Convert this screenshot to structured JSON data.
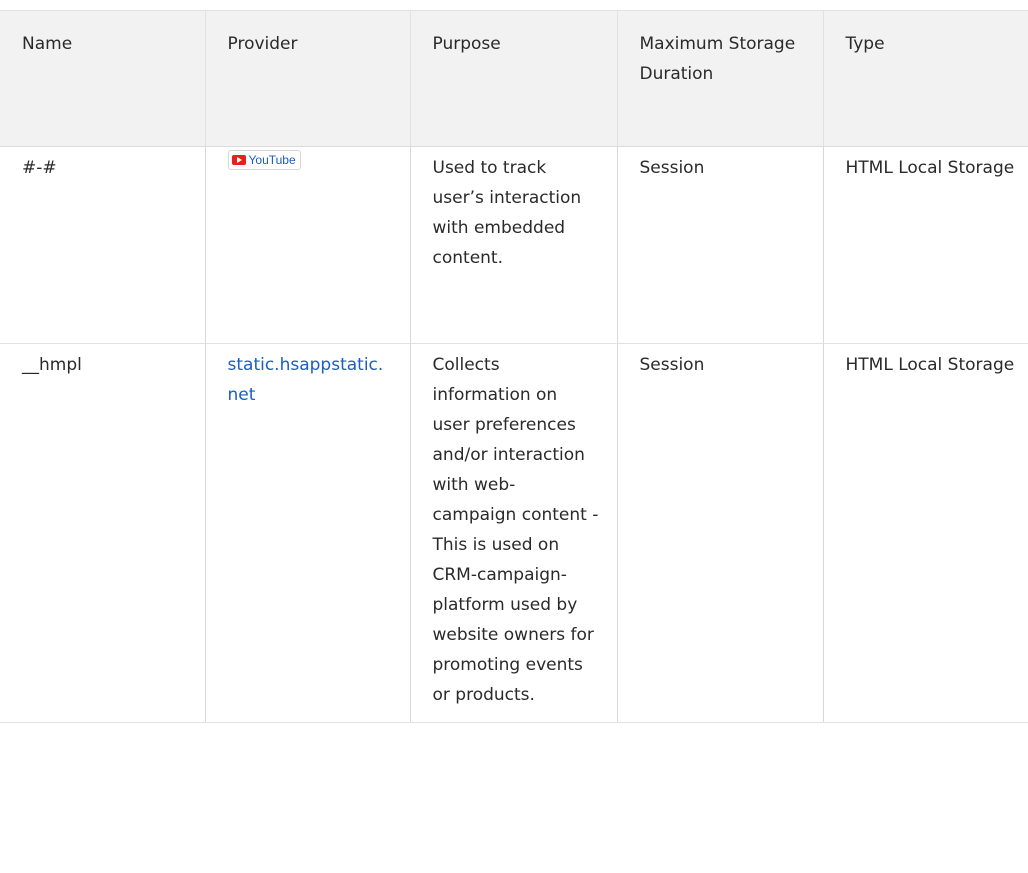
{
  "table": {
    "headers": {
      "name": "Name",
      "provider": "Provider",
      "purpose": "Purpose",
      "duration": "Maximum Storage Duration",
      "type": "Type"
    },
    "rows": [
      {
        "name": "#-#",
        "provider": "YouTube",
        "provider_icon": "youtube-icon",
        "purpose": "Used to track user’s interaction with embedded content.",
        "duration": "Session",
        "type": "HTML Local Storage"
      },
      {
        "name": "__hmpl",
        "provider": "static.hsappstatic.net",
        "purpose": "Collects information on user preferences and/or interaction with web-campaign content - This is used on CRM-campaign-platform used by website owners for promoting events or products.",
        "duration": "Session",
        "type": "HTML Local Storage"
      }
    ]
  },
  "colors": {
    "link": "#1a5dc4",
    "header_bg": "#f2f2f2",
    "youtube_red": "#e62117"
  }
}
